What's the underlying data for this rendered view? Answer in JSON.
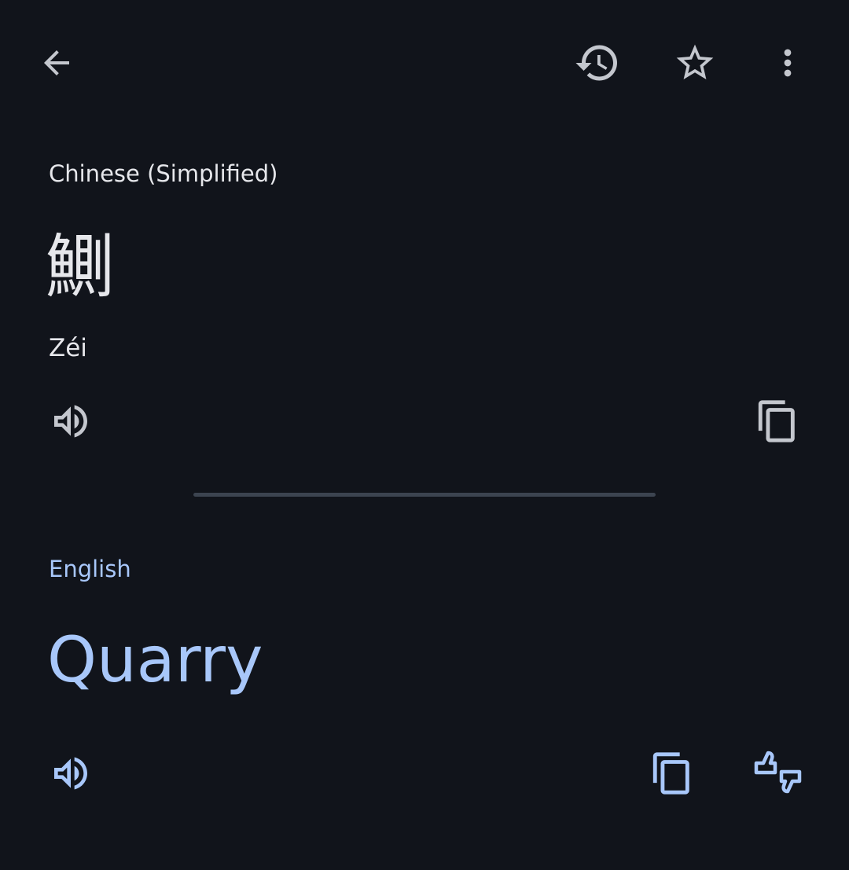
{
  "colors": {
    "background": "#11141b",
    "icon_light": "#c4c7ce",
    "text_light": "#e6e7eb",
    "accent": "#a8c7fa",
    "divider": "#3c4450"
  },
  "top_bar": {
    "icons": [
      "arrow-back-icon",
      "history-icon",
      "star-outline-icon",
      "more-vert-icon"
    ]
  },
  "source": {
    "language": "Chinese (Simplified)",
    "text": "鰂",
    "romanization": "Zéi",
    "icons": [
      "volume-up-icon",
      "copy-icon"
    ]
  },
  "target": {
    "language": "English",
    "text": "Quarry",
    "icons": [
      "volume-up-icon",
      "copy-icon",
      "feedback-thumbs-icon"
    ]
  }
}
